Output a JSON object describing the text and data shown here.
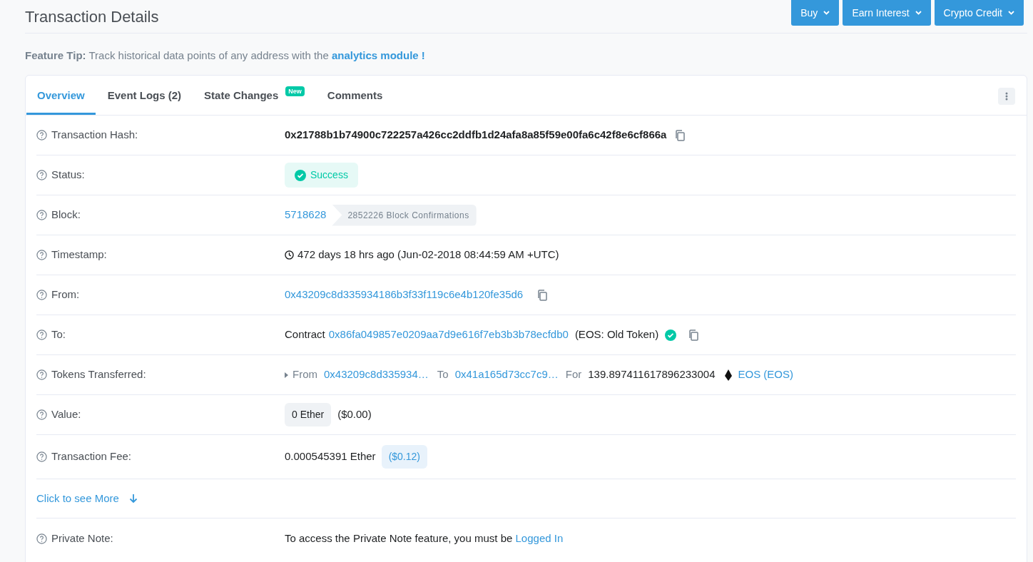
{
  "header": {
    "title": "Transaction Details",
    "buttons": [
      "Buy",
      "Earn Interest",
      "Crypto Credit"
    ]
  },
  "tip": {
    "text": "**Feature Tip:** Track historical data points of any address with the",
    "link": "analytics module !"
  },
  "tabs": [
    {
      "label": "Overview",
      "selected": true
    },
    {
      "label": "Event Logs (2)",
      "selected": false
    },
    {
      "label": "State Changes",
      "badge": "New",
      "selected": false
    },
    {
      "label": "Comments",
      "selected": false
    }
  ],
  "rows": [
    {
      "kind": "hash",
      "label": "Transaction Hash:",
      "value": "0x21788b1b74900c722257a426cc2ddfb1d24afa8a85f59e00fa6c42f8e6cf866a"
    },
    {
      "kind": "status",
      "label": "Status:",
      "value": "Success"
    },
    {
      "kind": "block",
      "label": "Block:",
      "value": "5718628",
      "confirmations": "2852226 Block Confirmations"
    },
    {
      "kind": "timestamp",
      "label": "Timestamp:",
      "value": "472 days 18 hrs ago (Jun-02-2018 08:44:59 AM +UTC)"
    },
    {
      "kind": "address",
      "label": "From:",
      "value": "0x43209c8d335934186b3f33f119c6e4b120fe35d6"
    },
    {
      "kind": "contract",
      "label": "To:",
      "prefix": "Contract",
      "value": "0x86fa049857e0209aa7d9e616f7eb3b3b78ecfdb0",
      "name": "(EOS: Old Token)",
      "verified": true
    },
    {
      "kind": "tokens",
      "label": "Tokens Transferred:",
      "from_label": "From",
      "from": "0x43209c8d335934…",
      "to_label": "To",
      "to": "0x41a165d73cc7c9…",
      "for_label": "For",
      "amount": "139.897411617896233004",
      "token": "EOS (EOS)"
    },
    {
      "kind": "value",
      "label": "Value:",
      "value": "0 Ether",
      "usd": "($0.00)"
    },
    {
      "kind": "fee",
      "label": "Transaction Fee:",
      "value": "0.000545391 Ether",
      "usd": "($0.12)"
    }
  ],
  "more": "Click to see More",
  "note": {
    "label": "Private Note:",
    "text": "To access the Private Note feature, you must be",
    "link": "Logged In"
  }
}
